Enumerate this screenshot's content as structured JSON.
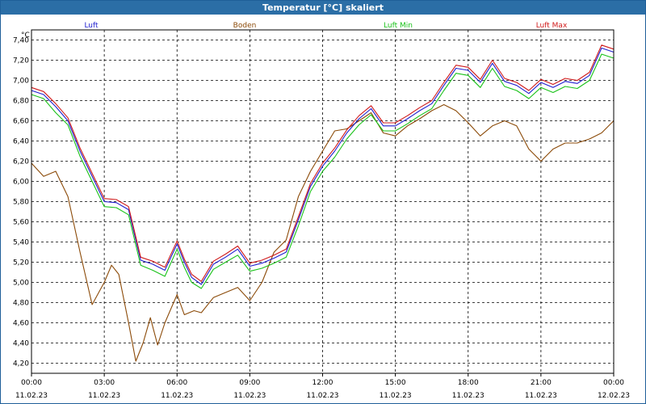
{
  "window": {
    "title": "Temperatur [°C] skaliert"
  },
  "colors": {
    "titlebar": "#2b6ea6",
    "grid": "#000000"
  },
  "chart_data": {
    "type": "line",
    "title": "Temperatur [°C] skaliert",
    "ylabel": "°C",
    "ylim": [
      4.1,
      7.5
    ],
    "y_ticks": [
      "7,40",
      "7,20",
      "7,00",
      "6,80",
      "6,60",
      "6,40",
      "6,20",
      "6,00",
      "5,80",
      "5,60",
      "5,40",
      "5,20",
      "5,00",
      "4,80",
      "4,60",
      "4,40",
      "4,20"
    ],
    "y_tick_values": [
      7.4,
      7.2,
      7.0,
      6.8,
      6.6,
      6.4,
      6.2,
      6.0,
      5.8,
      5.6,
      5.4,
      5.2,
      5.0,
      4.8,
      4.6,
      4.4,
      4.2
    ],
    "xlim": [
      0,
      24
    ],
    "x_ticks": [
      {
        "x": 0,
        "time": "00:00",
        "date": "11.02.23"
      },
      {
        "x": 3,
        "time": "03:00",
        "date": "11.02.23"
      },
      {
        "x": 6,
        "time": "06:00",
        "date": "11.02.23"
      },
      {
        "x": 9,
        "time": "09:00",
        "date": "11.02.23"
      },
      {
        "x": 12,
        "time": "12:00",
        "date": "11.02.23"
      },
      {
        "x": 15,
        "time": "15:00",
        "date": "11.02.23"
      },
      {
        "x": 18,
        "time": "18:00",
        "date": "11.02.23"
      },
      {
        "x": 21,
        "time": "21:00",
        "date": "11.02.23"
      },
      {
        "x": 24,
        "time": "00:00",
        "date": "12.02.23"
      }
    ],
    "grid": true,
    "legend_position": "top",
    "series": [
      {
        "name": "Luft",
        "color": "#1f1fd0",
        "points": [
          [
            0,
            6.9
          ],
          [
            0.5,
            6.86
          ],
          [
            1,
            6.74
          ],
          [
            1.5,
            6.6
          ],
          [
            2,
            6.3
          ],
          [
            2.5,
            6.05
          ],
          [
            3,
            5.8
          ],
          [
            3.5,
            5.79
          ],
          [
            4,
            5.72
          ],
          [
            4.5,
            5.22
          ],
          [
            5,
            5.18
          ],
          [
            5.5,
            5.12
          ],
          [
            6,
            5.38
          ],
          [
            6.3,
            5.2
          ],
          [
            6.6,
            5.05
          ],
          [
            7,
            4.98
          ],
          [
            7.5,
            5.18
          ],
          [
            8,
            5.25
          ],
          [
            8.5,
            5.33
          ],
          [
            9,
            5.16
          ],
          [
            9.5,
            5.19
          ],
          [
            10,
            5.24
          ],
          [
            10.5,
            5.3
          ],
          [
            11,
            5.62
          ],
          [
            11.5,
            5.95
          ],
          [
            12,
            6.15
          ],
          [
            12.5,
            6.3
          ],
          [
            13,
            6.48
          ],
          [
            13.5,
            6.62
          ],
          [
            14,
            6.72
          ],
          [
            14.5,
            6.55
          ],
          [
            15,
            6.55
          ],
          [
            15.5,
            6.62
          ],
          [
            16,
            6.7
          ],
          [
            16.5,
            6.77
          ],
          [
            17,
            6.95
          ],
          [
            17.5,
            7.12
          ],
          [
            18,
            7.1
          ],
          [
            18.5,
            6.98
          ],
          [
            19,
            7.17
          ],
          [
            19.5,
            6.99
          ],
          [
            20,
            6.95
          ],
          [
            20.5,
            6.87
          ],
          [
            21,
            6.98
          ],
          [
            21.5,
            6.93
          ],
          [
            22,
            6.99
          ],
          [
            22.5,
            6.97
          ],
          [
            23,
            7.05
          ],
          [
            23.5,
            7.32
          ],
          [
            24,
            7.28
          ]
        ]
      },
      {
        "name": "Boden",
        "color": "#8b4a08",
        "points": [
          [
            0,
            6.18
          ],
          [
            0.5,
            6.05
          ],
          [
            1,
            6.1
          ],
          [
            1.5,
            5.85
          ],
          [
            2,
            5.3
          ],
          [
            2.5,
            4.78
          ],
          [
            3,
            5.0
          ],
          [
            3.3,
            5.17
          ],
          [
            3.6,
            5.08
          ],
          [
            4,
            4.6
          ],
          [
            4.3,
            4.22
          ],
          [
            4.6,
            4.4
          ],
          [
            4.9,
            4.65
          ],
          [
            5.2,
            4.38
          ],
          [
            5.5,
            4.6
          ],
          [
            6,
            4.88
          ],
          [
            6.3,
            4.68
          ],
          [
            6.7,
            4.72
          ],
          [
            7,
            4.7
          ],
          [
            7.5,
            4.85
          ],
          [
            8,
            4.9
          ],
          [
            8.5,
            4.95
          ],
          [
            9,
            4.82
          ],
          [
            9.5,
            5.0
          ],
          [
            10,
            5.3
          ],
          [
            10.5,
            5.42
          ],
          [
            11,
            5.85
          ],
          [
            11.5,
            6.1
          ],
          [
            12,
            6.3
          ],
          [
            12.5,
            6.5
          ],
          [
            13,
            6.52
          ],
          [
            13.5,
            6.6
          ],
          [
            14,
            6.68
          ],
          [
            14.5,
            6.48
          ],
          [
            15,
            6.45
          ],
          [
            15.5,
            6.55
          ],
          [
            16,
            6.62
          ],
          [
            16.5,
            6.7
          ],
          [
            17,
            6.76
          ],
          [
            17.5,
            6.7
          ],
          [
            18,
            6.58
          ],
          [
            18.5,
            6.45
          ],
          [
            19,
            6.55
          ],
          [
            19.5,
            6.6
          ],
          [
            20,
            6.55
          ],
          [
            20.5,
            6.32
          ],
          [
            21,
            6.2
          ],
          [
            21.5,
            6.32
          ],
          [
            22,
            6.38
          ],
          [
            22.5,
            6.38
          ],
          [
            23,
            6.42
          ],
          [
            23.5,
            6.48
          ],
          [
            24,
            6.6
          ]
        ]
      },
      {
        "name": "Luft Min",
        "color": "#19c219",
        "points": [
          [
            0,
            6.86
          ],
          [
            0.5,
            6.82
          ],
          [
            1,
            6.68
          ],
          [
            1.5,
            6.56
          ],
          [
            2,
            6.25
          ],
          [
            2.5,
            6.0
          ],
          [
            3,
            5.75
          ],
          [
            3.5,
            5.74
          ],
          [
            4,
            5.67
          ],
          [
            4.5,
            5.17
          ],
          [
            5,
            5.12
          ],
          [
            5.5,
            5.06
          ],
          [
            6,
            5.33
          ],
          [
            6.3,
            5.15
          ],
          [
            6.6,
            5.0
          ],
          [
            7,
            4.94
          ],
          [
            7.5,
            5.13
          ],
          [
            8,
            5.2
          ],
          [
            8.5,
            5.27
          ],
          [
            9,
            5.11
          ],
          [
            9.5,
            5.14
          ],
          [
            10,
            5.19
          ],
          [
            10.5,
            5.25
          ],
          [
            11,
            5.56
          ],
          [
            11.5,
            5.9
          ],
          [
            12,
            6.1
          ],
          [
            12.5,
            6.24
          ],
          [
            13,
            6.42
          ],
          [
            13.5,
            6.56
          ],
          [
            14,
            6.66
          ],
          [
            14.5,
            6.5
          ],
          [
            15,
            6.5
          ],
          [
            15.5,
            6.57
          ],
          [
            16,
            6.65
          ],
          [
            16.5,
            6.72
          ],
          [
            17,
            6.9
          ],
          [
            17.5,
            7.07
          ],
          [
            18,
            7.05
          ],
          [
            18.5,
            6.93
          ],
          [
            19,
            7.12
          ],
          [
            19.5,
            6.94
          ],
          [
            20,
            6.9
          ],
          [
            20.5,
            6.82
          ],
          [
            21,
            6.93
          ],
          [
            21.5,
            6.88
          ],
          [
            22,
            6.94
          ],
          [
            22.5,
            6.92
          ],
          [
            23,
            7.0
          ],
          [
            23.5,
            7.26
          ],
          [
            24,
            7.22
          ]
        ]
      },
      {
        "name": "Luft Max",
        "color": "#d01a1a",
        "points": [
          [
            0,
            6.93
          ],
          [
            0.5,
            6.89
          ],
          [
            1,
            6.77
          ],
          [
            1.5,
            6.63
          ],
          [
            2,
            6.33
          ],
          [
            2.5,
            6.08
          ],
          [
            3,
            5.83
          ],
          [
            3.5,
            5.82
          ],
          [
            4,
            5.75
          ],
          [
            4.5,
            5.25
          ],
          [
            5,
            5.21
          ],
          [
            5.5,
            5.15
          ],
          [
            6,
            5.41
          ],
          [
            6.3,
            5.23
          ],
          [
            6.6,
            5.08
          ],
          [
            7,
            5.01
          ],
          [
            7.5,
            5.21
          ],
          [
            8,
            5.28
          ],
          [
            8.5,
            5.36
          ],
          [
            9,
            5.19
          ],
          [
            9.5,
            5.22
          ],
          [
            10,
            5.27
          ],
          [
            10.5,
            5.33
          ],
          [
            11,
            5.65
          ],
          [
            11.5,
            5.98
          ],
          [
            12,
            6.18
          ],
          [
            12.5,
            6.33
          ],
          [
            13,
            6.51
          ],
          [
            13.5,
            6.65
          ],
          [
            14,
            6.75
          ],
          [
            14.5,
            6.58
          ],
          [
            15,
            6.58
          ],
          [
            15.5,
            6.65
          ],
          [
            16,
            6.73
          ],
          [
            16.5,
            6.8
          ],
          [
            17,
            6.98
          ],
          [
            17.5,
            7.15
          ],
          [
            18,
            7.13
          ],
          [
            18.5,
            7.01
          ],
          [
            19,
            7.2
          ],
          [
            19.5,
            7.02
          ],
          [
            20,
            6.98
          ],
          [
            20.5,
            6.9
          ],
          [
            21,
            7.01
          ],
          [
            21.5,
            6.96
          ],
          [
            22,
            7.02
          ],
          [
            22.5,
            7.0
          ],
          [
            23,
            7.08
          ],
          [
            23.5,
            7.35
          ],
          [
            24,
            7.31
          ]
        ]
      }
    ]
  }
}
